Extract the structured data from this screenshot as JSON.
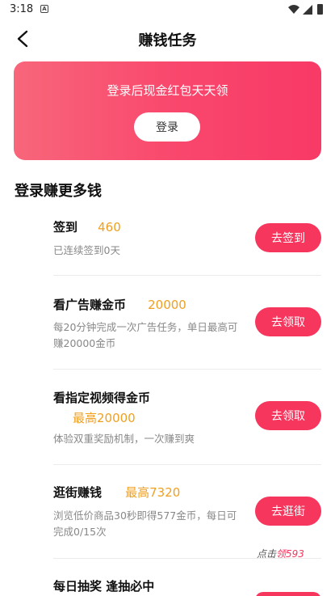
{
  "status_bar": {
    "time": "3:18",
    "notif_letter": "A"
  },
  "nav": {
    "title": "赚钱任务"
  },
  "banner": {
    "text": "登录后现金红包天天领",
    "login_label": "登录"
  },
  "section": {
    "title": "登录赚更多钱"
  },
  "tasks": [
    {
      "name": "签到",
      "reward": "460",
      "desc": "已连续签到0天",
      "button": "去签到"
    },
    {
      "name": "看广告赚金币",
      "reward": "20000",
      "desc": "每20分钟完成一次广告任务，单日最高可赚20000金币",
      "button": "去领取"
    },
    {
      "name": "看指定视频得金币",
      "reward": "最高20000",
      "desc": "体验双重奖励机制，一次赚到爽",
      "button": "去领取"
    },
    {
      "name": "逛街赚钱",
      "reward": "最高7320",
      "desc": "浏览低价商品30秒即得577金币，每日可完成0/15次",
      "button": "去逛街"
    },
    {
      "name": "每日抽奖 逢抽必中",
      "reward": "",
      "desc": "",
      "button": ""
    }
  ],
  "float_tip": {
    "prefix": "点击",
    "highlight": "领593"
  },
  "colors": {
    "accent": "#f7365e",
    "reward": "#f0a020",
    "banner_start": "#f8667b",
    "banner_end": "#f83a66"
  }
}
